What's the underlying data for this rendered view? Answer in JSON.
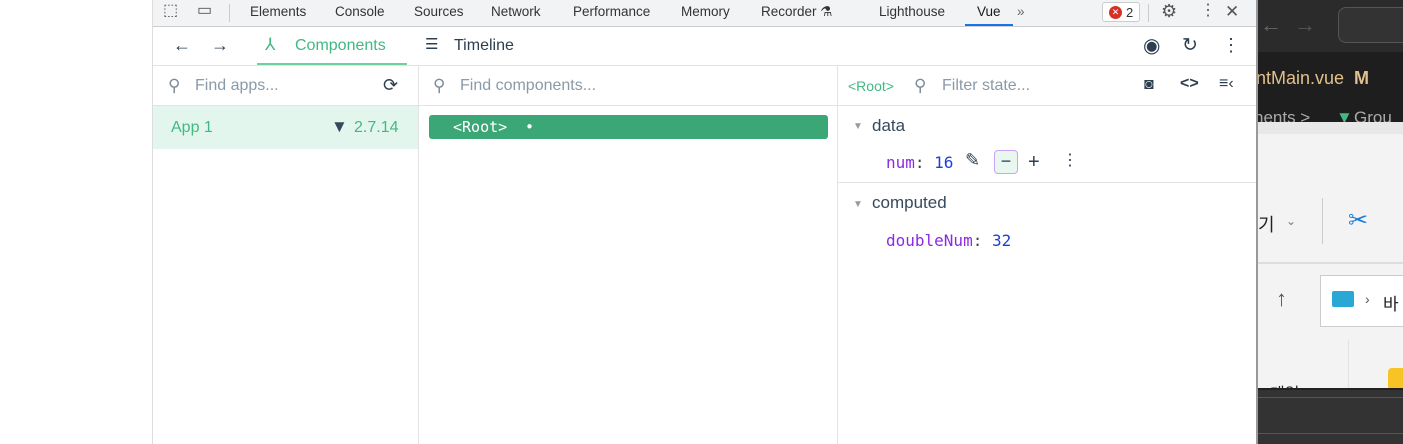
{
  "devtools_tabs": [
    "Elements",
    "Console",
    "Sources",
    "Network",
    "Performance",
    "Memory",
    "Recorder",
    "Lighthouse",
    "Vue"
  ],
  "active_tab": "Vue",
  "error_count": "2",
  "vue_toolbar": {
    "components_label": "Components",
    "timeline_label": "Timeline"
  },
  "apps_panel": {
    "search_placeholder": "Find apps...",
    "apps": [
      {
        "name": "App 1",
        "version": "2.7.14"
      }
    ]
  },
  "components_panel": {
    "search_placeholder": "Find components...",
    "tree": [
      {
        "label": "<Root>",
        "dot": "•"
      }
    ]
  },
  "state_panel": {
    "selected": "<Root>",
    "filter_placeholder": "Filter state...",
    "sections": [
      {
        "title": "data",
        "items": [
          {
            "key": "num",
            "value": "16"
          }
        ]
      },
      {
        "title": "computed",
        "items": [
          {
            "key": "doubleNum",
            "value": "32"
          }
        ]
      }
    ]
  },
  "background_window": {
    "file_tab": "ntMain.vue",
    "file_status": "M",
    "breadcrumb": "nents >",
    "breadcrumb2": "Grou",
    "korean_text": "기",
    "korean_text2": "바",
    "korean_text3": "게임"
  },
  "colors": {
    "vue_green": "#42b883",
    "selected_bg": "#e2f6ed",
    "key_purple": "#8a2be2",
    "value_blue": "#1d3fd8",
    "devtools_blue": "#1a73e8"
  }
}
